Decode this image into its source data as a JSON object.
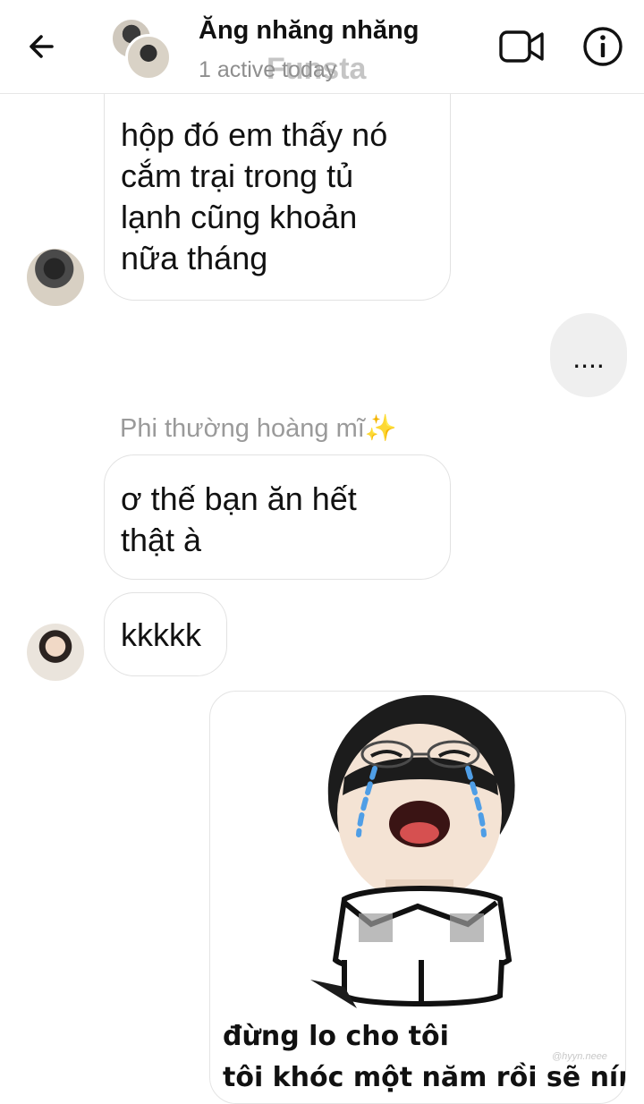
{
  "header": {
    "contact_name": "Ăng nhăng nhăng",
    "status": "1 active today",
    "watermark": "Funsta"
  },
  "icons": {
    "back": "arrow-left-icon",
    "video": "video-camera-icon",
    "info": "info-circle-icon"
  },
  "messages": [
    {
      "direction": "incoming",
      "text": "hộp đó em thấy nó\ncắm trại trong tủ\nlạnh cũng khoản\nnữa tháng"
    },
    {
      "direction": "outgoing",
      "text": "...."
    },
    {
      "sender": "Phi thường hoàng mĩ",
      "sender_emoji": "✨",
      "direction": "incoming",
      "text": "ơ thế bạn ăn hết\nthật à"
    },
    {
      "direction": "incoming",
      "text": "kkkkk"
    }
  ],
  "sticker": {
    "caption_line1": "đừng lo cho tôi",
    "caption_line2": "tôi khóc một năm rồi sẽ nín",
    "credit": "@hyyn.neee"
  },
  "colors": {
    "bubble_outgoing": "#efefef",
    "bubble_border": "#e2e2e2",
    "muted_text": "#8e8e8e",
    "tear_blue": "#4f9ee6"
  }
}
